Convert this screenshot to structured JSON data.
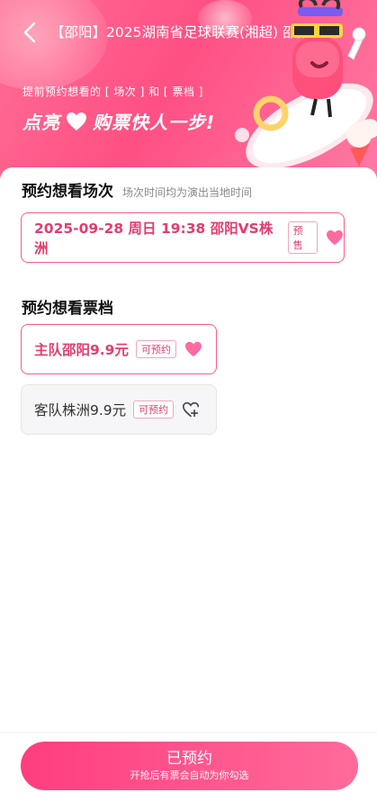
{
  "header": {
    "title": "【邵阳】2025湖南省足球联赛(湘超) 邵阳赛区",
    "subtitle": "提前预约想看的 [ 场次 ] 和 [ 票档 ]",
    "slogan_left": "点亮",
    "slogan_right": "购票快人一步!"
  },
  "session_section": {
    "title": "预约想看场次",
    "note": "场次时间均为演出当地时间",
    "items": [
      {
        "label": "2025-09-28 周日 19:38 邵阳VS株洲",
        "tag": "预售",
        "selected": true
      }
    ]
  },
  "ticket_section": {
    "title": "预约想看票档",
    "items": [
      {
        "label": "主队邵阳9.9元",
        "tag": "可预约",
        "selected": true
      },
      {
        "label": "客队株洲9.9元",
        "tag": "可预约",
        "selected": false
      }
    ]
  },
  "cta": {
    "label": "已预约",
    "sub": "开抢后有票会自动为你勾选"
  },
  "colors": {
    "accent": "#ff4f83",
    "selected_text": "#e23d6e",
    "heart": "#ff6aa0"
  },
  "icons": [
    "back-arrow-icon",
    "heart-filled-icon",
    "heart-add-icon",
    "mascot-illustration"
  ]
}
